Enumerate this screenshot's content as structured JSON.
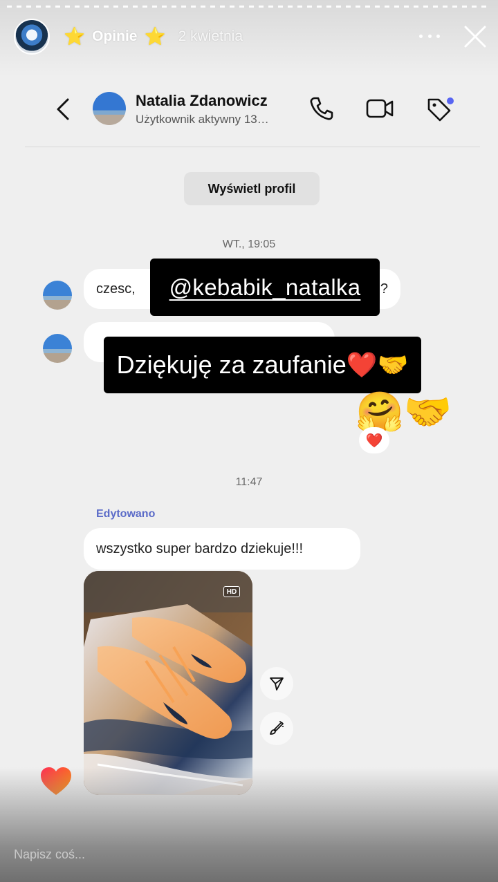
{
  "story": {
    "title": "Opinie",
    "date": "2 kwietnia",
    "star": "⭐",
    "icons": [
      "more-icon",
      "close-icon"
    ]
  },
  "chat": {
    "name": "Natalia Zdanowicz",
    "status": "Użytkownik aktywny 13…",
    "profile_button": "Wyświetl profil",
    "icons": [
      "back-icon",
      "phone-icon",
      "video-icon",
      "tag-icon"
    ]
  },
  "messages": {
    "stamp_1": "WT., 19:05",
    "msg_1_start": "czesc,",
    "msg_1_end": "?",
    "stamp_2": "11:47",
    "edited_label": "Edytowano",
    "msg_3": "wszystko super bardzo dziekuje!!!",
    "big_emoji": "🤗🤝",
    "reaction": "❤️",
    "photo_badge": "HD"
  },
  "stickers": {
    "mention": "@kebabik_natalka",
    "thanks": "Dziękuję za zaufanie❤️🤝"
  },
  "compose": {
    "placeholder": "Napisz coś..."
  },
  "colors": {
    "accent_blue": "#5865f2",
    "edited_label": "#5b6bc8",
    "tag_dot": "#5865f2"
  }
}
